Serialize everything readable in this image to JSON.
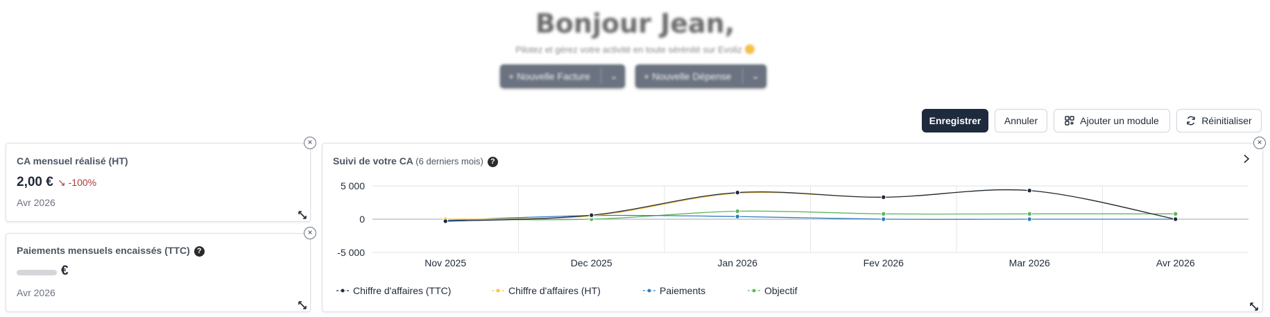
{
  "greeting": {
    "title": "Bonjour Jean,",
    "subtitle": "Pilotez et gérez votre activité en toute sérénité sur Evoliz",
    "new_invoice": "+ Nouvelle Facture",
    "new_expense": "+ Nouvelle Dépense"
  },
  "toolbar": {
    "save": "Enregistrer",
    "cancel": "Annuler",
    "add_module": "Ajouter un module",
    "reset": "Réinitialiser"
  },
  "card_ca": {
    "title": "CA mensuel réalisé (HT)",
    "value": "2,00 €",
    "delta_arrow": "↘",
    "delta": "-100%",
    "date": "Avr 2026"
  },
  "card_payments": {
    "title": "Paiements mensuels encaissés (TTC)",
    "help": "?",
    "currency": "€",
    "date": "Avr 2026"
  },
  "chart_card": {
    "title": "Suivi de votre CA",
    "subtitle": "(6 derniers mois)",
    "help": "?"
  },
  "chart_data": {
    "type": "line",
    "categories": [
      "Nov 2025",
      "Dec 2025",
      "Jan 2026",
      "Fev 2026",
      "Mar 2026",
      "Avr 2026"
    ],
    "ylim": [
      -5000,
      5000
    ],
    "yticks": [
      5000,
      0,
      -5000
    ],
    "ytick_labels": [
      "5 000",
      "0",
      "-5 000"
    ],
    "grid": true,
    "legend_position": "bottom-left",
    "series": [
      {
        "name": "Chiffre d'affaires (TTC)",
        "color": "#1e2a3d",
        "values": [
          -300,
          600,
          4000,
          3300,
          4300,
          2
        ]
      },
      {
        "name": "Chiffre d'affaires (HT)",
        "color": "#f5c444",
        "values": [
          0,
          500,
          3900,
          3300,
          4300,
          2
        ]
      },
      {
        "name": "Paiements",
        "color": "#2f7dc1",
        "values": [
          -200,
          550,
          400,
          0,
          0,
          0
        ]
      },
      {
        "name": "Objectif",
        "color": "#5cb85c",
        "values": [
          0,
          0,
          1200,
          800,
          800,
          800
        ]
      }
    ]
  }
}
